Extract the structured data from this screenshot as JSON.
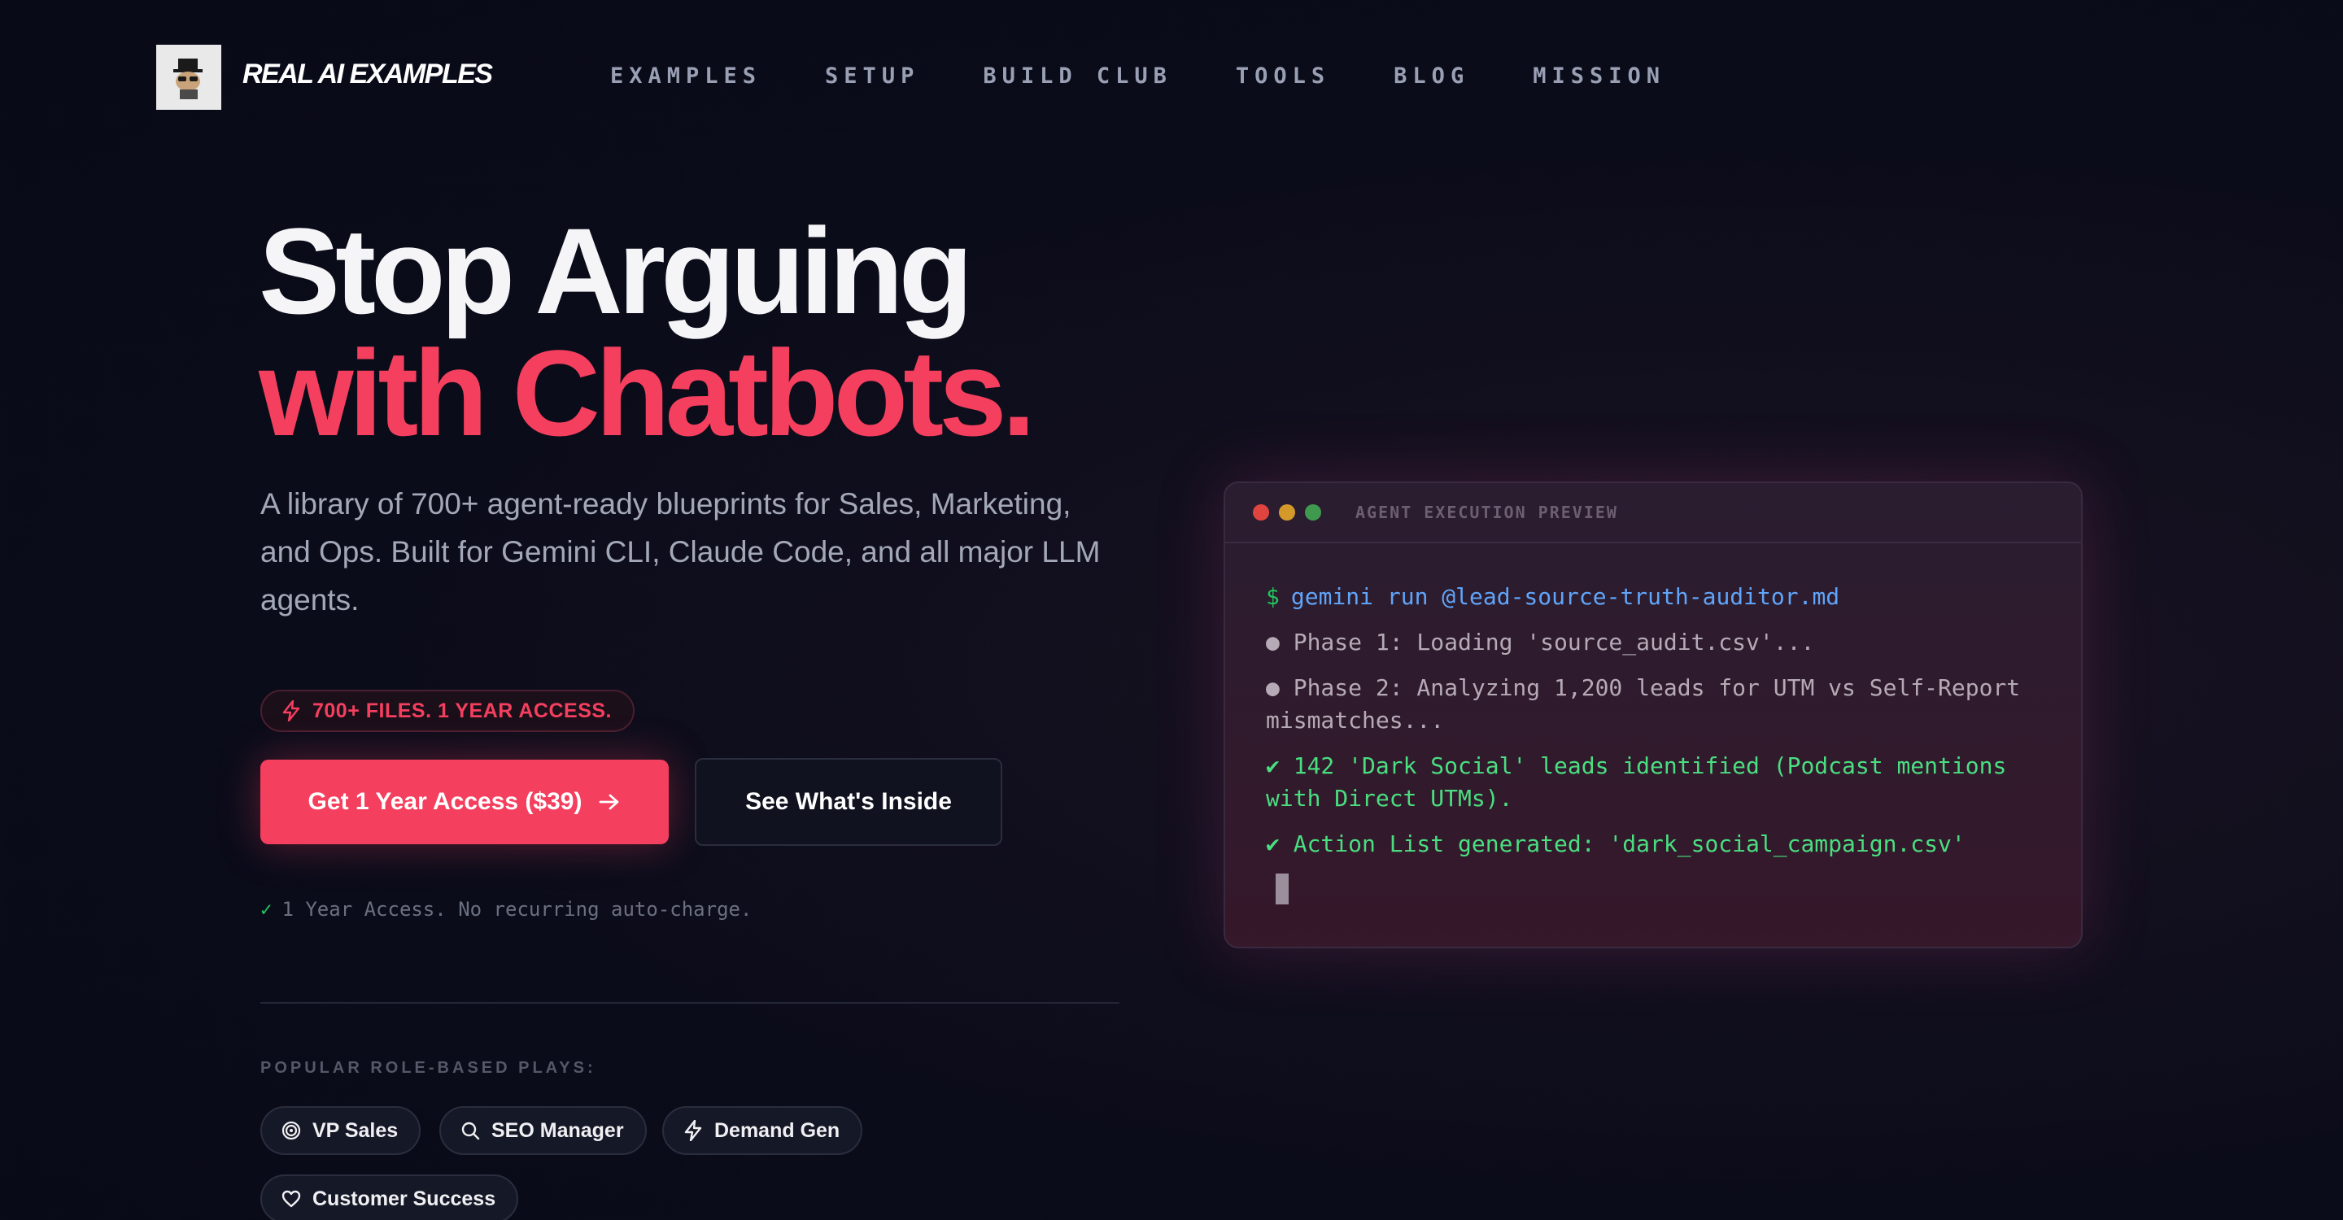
{
  "nav": {
    "logo_text": "REAL AI EXAMPLES",
    "links": [
      "EXAMPLES",
      "SETUP",
      "BUILD CLUB",
      "TOOLS",
      "BLOG",
      "MISSION"
    ]
  },
  "hero": {
    "title_line1": "Stop Arguing",
    "title_line2": "with Chatbots.",
    "subtitle": "A library of 700+ agent-ready blueprints for Sales, Marketing, and Ops. Built for Gemini CLI, Claude Code, and all major LLM agents.",
    "badge": "700+ FILES. 1 YEAR ACCESS.",
    "primary_button": "Get 1 Year Access ($39)",
    "secondary_button": "See What's Inside",
    "note": "1 Year Access. No recurring auto-charge."
  },
  "plays": {
    "label": "POPULAR ROLE-BASED PLAYS:",
    "chips": [
      "VP Sales",
      "SEO Manager",
      "Demand Gen",
      "Customer Success"
    ]
  },
  "terminal": {
    "title": "AGENT EXECUTION PREVIEW",
    "prompt": "$",
    "command": "gemini run @lead-source-truth-auditor.md",
    "line1": "● Phase 1: Loading 'source_audit.csv'...",
    "line2": "● Phase 2: Analyzing 1,200 leads for UTM vs Self-Report mismatches...",
    "line3": "✔ 142 'Dark Social' leads identified (Podcast mentions with Direct UTMs).",
    "line4": "✔ Action List generated: 'dark_social_campaign.csv'"
  },
  "colors": {
    "accent": "#f43f5e",
    "background": "#0b0c1a",
    "success": "#22c55e",
    "command": "#60a5fa"
  }
}
